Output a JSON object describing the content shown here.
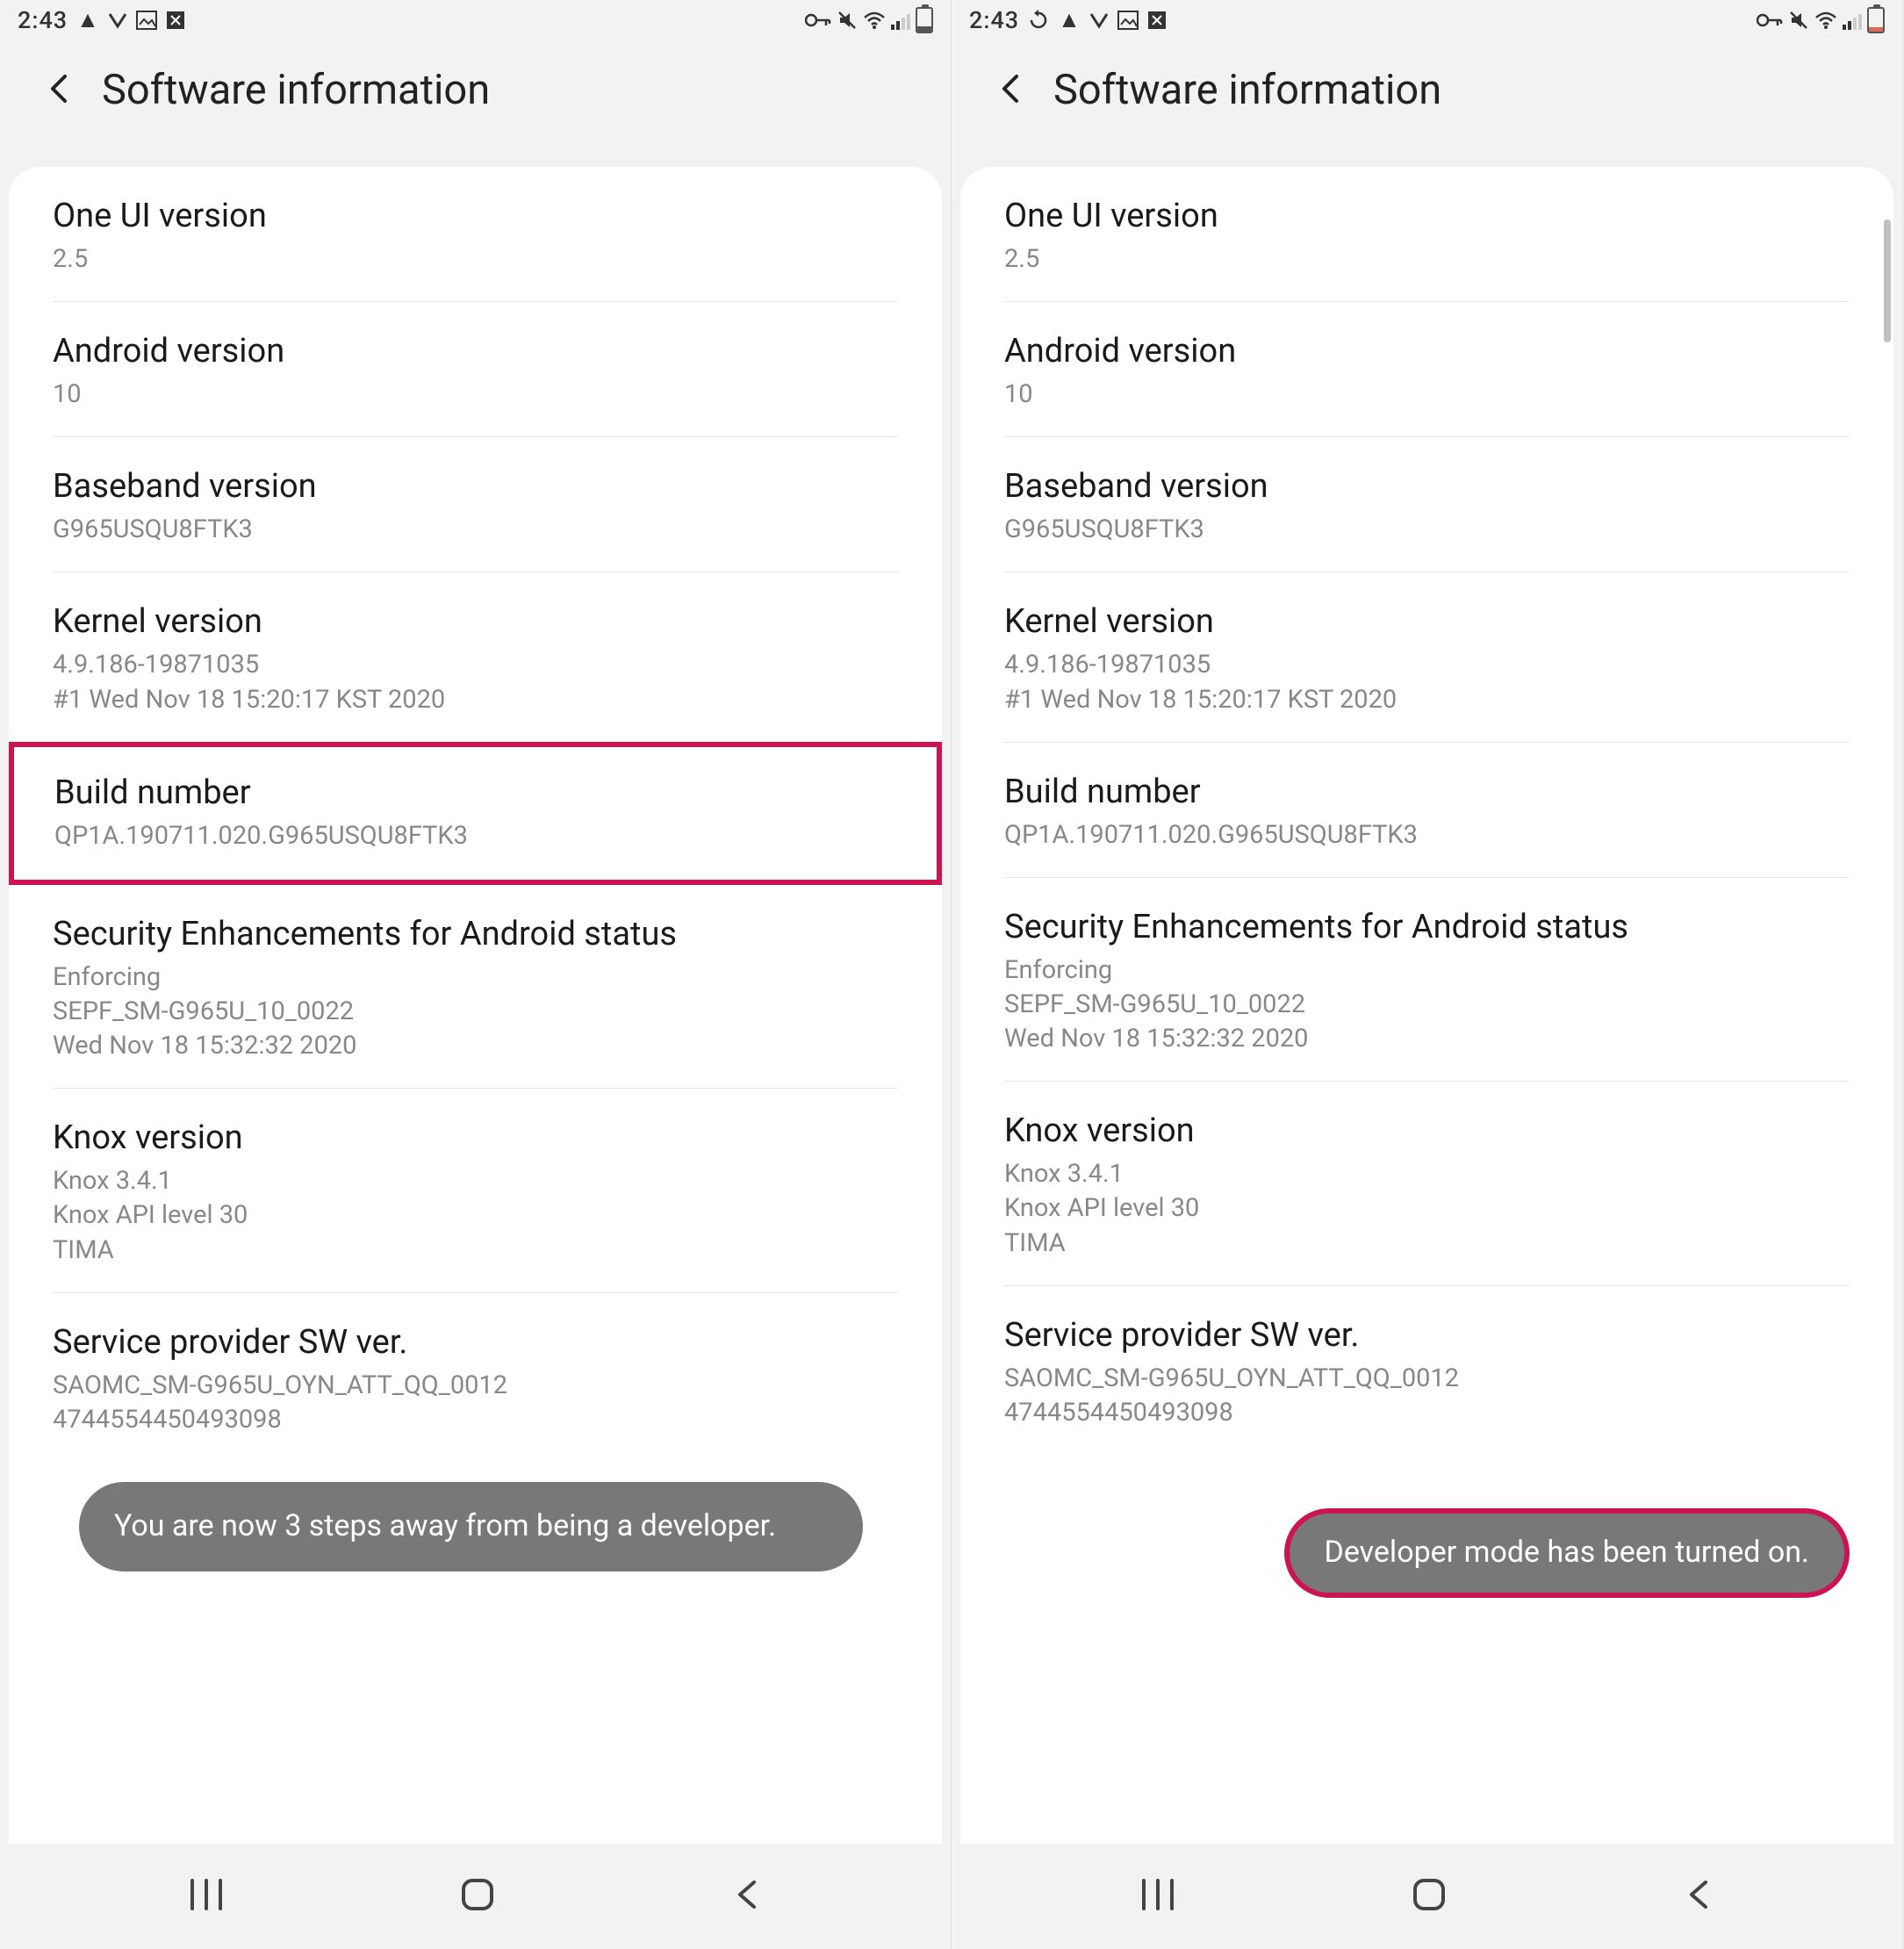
{
  "statusbar": {
    "time": "2:43",
    "iconsLeftA": [
      "warning",
      "v-check",
      "image",
      "x-box"
    ],
    "iconsLeftB": [
      "refresh",
      "warning",
      "v-check",
      "image",
      "x-box"
    ],
    "iconsRight": [
      "key",
      "mute",
      "wifi",
      "signal",
      "battery"
    ]
  },
  "header": {
    "title": "Software information"
  },
  "rows": [
    {
      "key": "one_ui",
      "title": "One UI version",
      "value": "2.5"
    },
    {
      "key": "android",
      "title": "Android version",
      "value": "10"
    },
    {
      "key": "baseband",
      "title": "Baseband version",
      "value": "G965USQU8FTK3"
    },
    {
      "key": "kernel",
      "title": "Kernel version",
      "value": "4.9.186-19871035\n#1 Wed Nov 18 15:20:17 KST 2020"
    },
    {
      "key": "build",
      "title": "Build number",
      "value": "QP1A.190711.020.G965USQU8FTK3"
    },
    {
      "key": "se",
      "title": "Security Enhancements for Android status",
      "value": "Enforcing\nSEPF_SM-G965U_10_0022\nWed Nov 18 15:32:32 2020"
    },
    {
      "key": "knox",
      "title": "Knox version",
      "value": "Knox 3.4.1\nKnox API level 30\nTIMA"
    },
    {
      "key": "svc",
      "title": "Service provider SW ver.",
      "value": "SAOMC_SM-G965U_OYN_ATT_QQ_0012\n4744554450493098"
    }
  ],
  "toasts": {
    "steps": "You are now 3 steps away from being a developer.",
    "devmode": "Developer mode has been turned on."
  },
  "highlight": {
    "left_row_key": "build",
    "right_toast_outlined": true
  },
  "colors": {
    "highlight": "#cc1550",
    "toast_bg": "#787878"
  }
}
